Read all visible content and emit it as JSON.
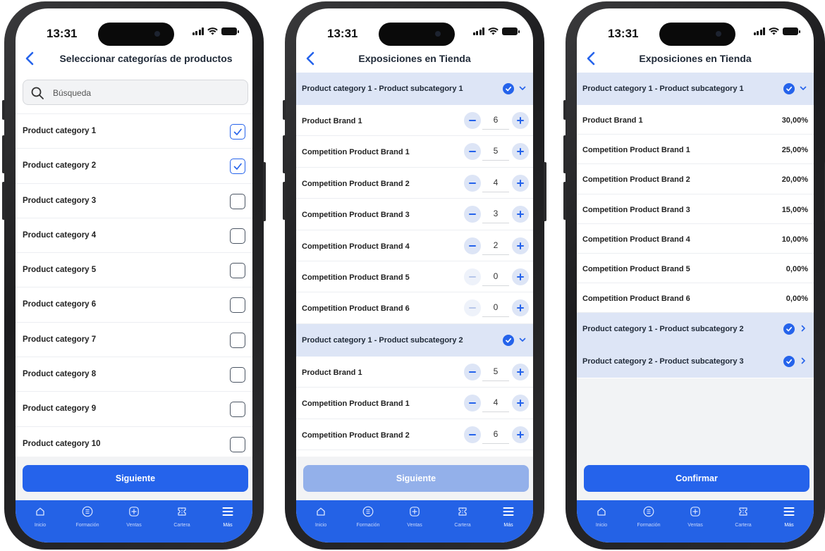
{
  "status": {
    "time": "13:31"
  },
  "screen1": {
    "title": "Seleccionar categorías de productos",
    "search_placeholder": "Búsqueda",
    "items": [
      {
        "label": "Product category 1",
        "checked": true
      },
      {
        "label": "Product category 2",
        "checked": true
      },
      {
        "label": "Product category 3",
        "checked": false
      },
      {
        "label": "Product category 4",
        "checked": false
      },
      {
        "label": "Product category 5",
        "checked": false
      },
      {
        "label": "Product category 6",
        "checked": false
      },
      {
        "label": "Product category 7",
        "checked": false
      },
      {
        "label": "Product category 8",
        "checked": false
      },
      {
        "label": "Product category 9",
        "checked": false
      },
      {
        "label": "Product category 10",
        "checked": false
      }
    ],
    "button": "Siguiente"
  },
  "screen2": {
    "title": "Exposiciones en Tienda",
    "sections": [
      {
        "label": "Product category 1 - Product subcategory 1",
        "brands": [
          {
            "label": "Product Brand 1",
            "qty": "6"
          },
          {
            "label": "Competition Product Brand 1",
            "qty": "5"
          },
          {
            "label": "Competition Product Brand 2",
            "qty": "4"
          },
          {
            "label": "Competition Product Brand 3",
            "qty": "3"
          },
          {
            "label": "Competition Product Brand 4",
            "qty": "2"
          },
          {
            "label": "Competition Product Brand 5",
            "qty": "0"
          },
          {
            "label": "Competition Product Brand 6",
            "qty": "0"
          }
        ]
      },
      {
        "label": "Product category 1 - Product subcategory 2",
        "brands": [
          {
            "label": "Product Brand 1",
            "qty": "5"
          },
          {
            "label": "Competition Product Brand 1",
            "qty": "4"
          },
          {
            "label": "Competition Product Brand 2",
            "qty": "6"
          }
        ]
      }
    ],
    "button": "Siguiente"
  },
  "screen3": {
    "title": "Exposiciones en Tienda",
    "expanded_section": "Product category 1 - Product subcategory 1",
    "rows": [
      {
        "label": "Product Brand 1",
        "pct": "30,00%"
      },
      {
        "label": "Competition Product Brand 1",
        "pct": "25,00%"
      },
      {
        "label": "Competition Product Brand 2",
        "pct": "20,00%"
      },
      {
        "label": "Competition Product Brand 3",
        "pct": "15,00%"
      },
      {
        "label": "Competition Product Brand 4",
        "pct": "10,00%"
      },
      {
        "label": "Competition Product Brand 5",
        "pct": "0,00%"
      },
      {
        "label": "Competition Product Brand 6",
        "pct": "0,00%"
      }
    ],
    "collapsed_sections": [
      "Product category 1 - Product subcategory 2",
      "Product category 2 - Product subcategory 3"
    ],
    "button": "Confirmar"
  },
  "tabbar": [
    {
      "label": "Inicio",
      "icon": "home-icon"
    },
    {
      "label": "Formación",
      "icon": "book-icon"
    },
    {
      "label": "Ventas",
      "icon": "plus-square-icon"
    },
    {
      "label": "Cartera",
      "icon": "wallet-icon"
    },
    {
      "label": "Más",
      "icon": "menu-icon",
      "active": true
    }
  ],
  "colors": {
    "primary": "#2563eb",
    "section_bg": "#dde5f6",
    "tabbar": "#2462e6"
  }
}
